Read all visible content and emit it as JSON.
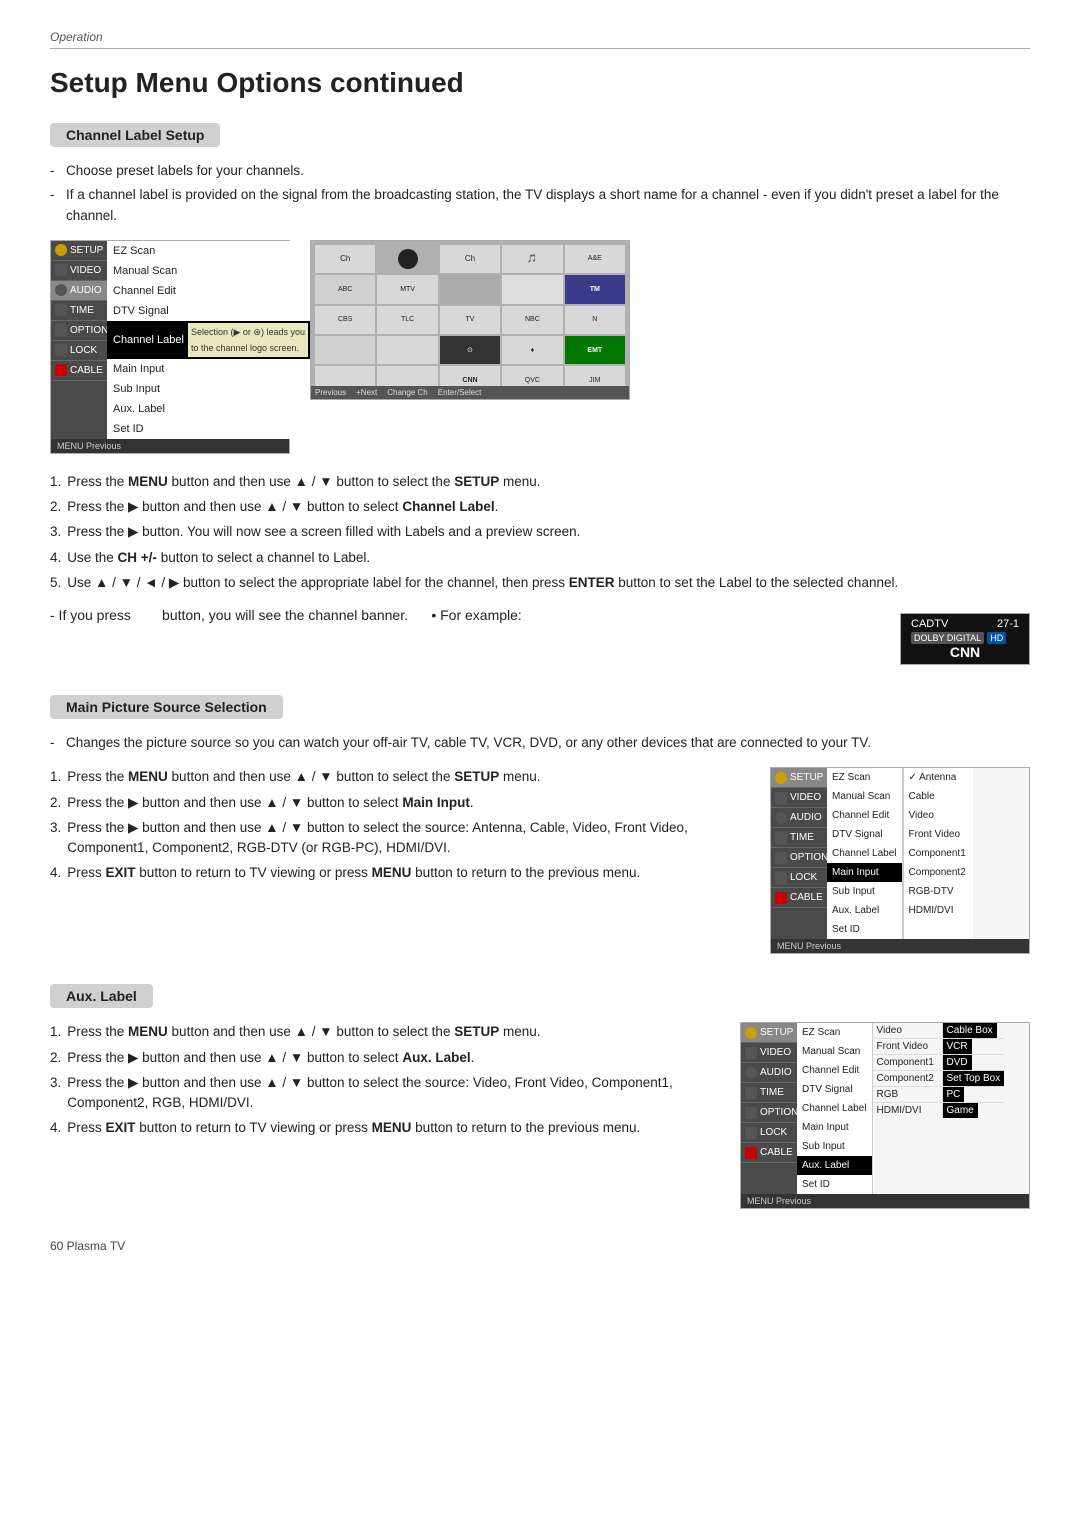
{
  "page": {
    "operation_label": "Operation",
    "title": "Setup Menu Options continued",
    "footer": "60  Plasma TV"
  },
  "channel_label_section": {
    "header": "Channel Label Setup",
    "bullets": [
      "Choose preset labels for your channels.",
      "If a channel label is provided on the signal from the broadcasting station, the TV displays a short name for a channel - even if you didn't preset a label for the channel."
    ],
    "menu1": {
      "left_items": [
        {
          "icon": "setup",
          "label": "SETUP"
        },
        {
          "icon": "video",
          "label": "VIDEO"
        },
        {
          "icon": "audio",
          "label": "AUDIO"
        },
        {
          "icon": "time",
          "label": "TIME"
        },
        {
          "icon": "option",
          "label": "OPTION"
        },
        {
          "icon": "lock",
          "label": "LOCK"
        },
        {
          "icon": "cable",
          "label": "CABLE"
        }
      ],
      "right_items": [
        "EZ Scan",
        "Manual Scan",
        "Channel Edit",
        "DTV Signal",
        "Channel Label",
        "Main Input",
        "Sub Input",
        "Aux. Label",
        "Set ID"
      ],
      "highlighted": "Channel Label",
      "popup_text": "Selection (▶ or ⊛) leads you\nto the channel logo screen.",
      "bottom_items": [
        "MENU Previous"
      ]
    },
    "steps": [
      {
        "num": "1.",
        "text": "Press the ",
        "bold": "MENU",
        "rest": " button and then use ▲ / ▼ button to select the ",
        "bold2": "SETUP",
        "end": " menu."
      },
      {
        "num": "2.",
        "text": "Press the ▶ button and then use ▲ / ▼ button to select ",
        "bold": "Channel Label",
        "end": "."
      },
      {
        "num": "3.",
        "text": "Press the ▶ button. You will now see a screen filled with Labels and a preview screen."
      },
      {
        "num": "4.",
        "text": "Use the ",
        "bold": "CH +/-",
        "rest": " button to select a channel to Label."
      },
      {
        "num": "5.",
        "text": "Use ▲ / ▼ / ◄ / ▶ button to select the appropriate label for the channel, then press ",
        "bold": "ENTER",
        "rest": " button to set the Label to the selected channel."
      }
    ],
    "note": "If you press      button, you will see the channel banner.",
    "for_example": "For example:",
    "banner": {
      "station": "CADTV",
      "number": "27-1",
      "badges": [
        "DOLBY DIGITAL",
        "HD"
      ],
      "channel_name": "CNN"
    }
  },
  "main_picture_section": {
    "header": "Main Picture Source Selection",
    "bullet": "Changes the picture source so you can watch your off-air TV, cable TV, VCR, DVD, or any other devices that are connected to your TV.",
    "steps": [
      {
        "num": "1.",
        "text": "Press the ",
        "bold": "MENU",
        "rest": " button and then use ▲ / ▼ button to select the ",
        "bold2": "SETUP",
        "end": " menu."
      },
      {
        "num": "2.",
        "text": "Press the ▶ button and then use ▲ / ▼ button to select ",
        "bold": "Main Input",
        "end": "."
      },
      {
        "num": "3.",
        "text": "Press the ▶ button and then use ▲ / ▼ button to select the source: Antenna, Cable, Video, Front Video, Component1, Component2, RGB-DTV (or RGB-PC), HDMI/DVI."
      },
      {
        "num": "4.",
        "text": "Press ",
        "bold": "EXIT",
        "rest": " button to return to TV viewing or press ",
        "bold2": "MENU",
        "rest2": " button to return to the previous menu."
      }
    ],
    "menu2": {
      "highlighted_left": "SETUP",
      "right_items": [
        "EZ Scan",
        "Manual Scan",
        "Channel Edit",
        "DTV Signal",
        "Channel Label",
        "Main Input",
        "Sub Input",
        "Aux. Label",
        "Set ID"
      ],
      "highlighted_right": "Main Input",
      "sub_items": [
        "Antenna",
        "Cable",
        "Video",
        "Front Video",
        "Component1",
        "Component2",
        "RGB-DTV",
        "HDMI/DVI"
      ],
      "checked": "Antenna"
    }
  },
  "aux_label_section": {
    "header": "Aux. Label",
    "steps": [
      {
        "num": "1.",
        "text": "Press the ",
        "bold": "MENU",
        "rest": " button and then use ▲ / ▼ button to select the ",
        "bold2": "SETUP",
        "end": " menu."
      },
      {
        "num": "2.",
        "text": "Press the ▶ button and then use ▲ / ▼ button to select ",
        "bold": "Aux. Label",
        "end": "."
      },
      {
        "num": "3.",
        "text": "Press the ▶ button and then use ▲ / ▼ button to select the source: Video, Front Video, Component1, Component2, RGB, HDMI/DVI."
      },
      {
        "num": "4.",
        "text": "Press ",
        "bold": "EXIT",
        "rest": " button to return to TV viewing or press ",
        "bold2": "MENU",
        "rest2": " button to return to the previous menu."
      }
    ],
    "menu3": {
      "right_items": [
        "EZ Scan",
        "Manual Scan",
        "Channel Edit",
        "DTV Signal",
        "Channel Label",
        "Main Input",
        "Sub Input",
        "Aux. Label",
        "Set ID"
      ],
      "highlighted_right": "Aux. Label",
      "sub_items_pairs": [
        {
          "source": "Video",
          "label": "Cable Box"
        },
        {
          "source": "Front Video",
          "label": "VCR"
        },
        {
          "source": "Component1",
          "label": "DVD"
        },
        {
          "source": "Component2",
          "label": "Set Top Box"
        },
        {
          "source": "RGB",
          "label": "PC"
        },
        {
          "source": "HDMI/DVI",
          "label": "Game"
        }
      ]
    }
  }
}
